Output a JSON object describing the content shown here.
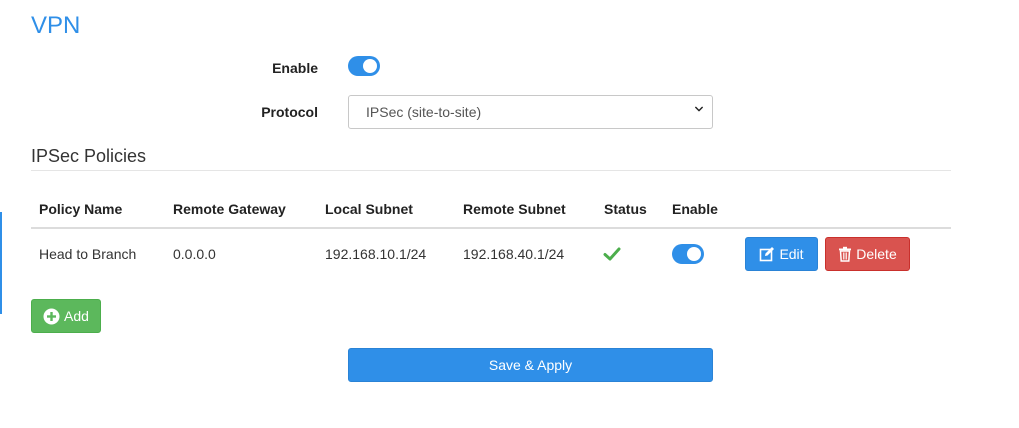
{
  "page": {
    "title": "VPN"
  },
  "form": {
    "enable_label": "Enable",
    "enable_on": true,
    "protocol_label": "Protocol",
    "protocol_value": "IPSec (site-to-site)"
  },
  "policies": {
    "section_title": "IPSec Policies",
    "columns": [
      "Policy Name",
      "Remote Gateway",
      "Local Subnet",
      "Remote Subnet",
      "Status",
      "Enable"
    ],
    "rows": [
      {
        "policy_name": "Head to Branch",
        "remote_gateway": "0.0.0.0",
        "local_subnet": "192.168.10.1/24",
        "remote_subnet": "192.168.40.1/24",
        "status_icon": "check-icon",
        "enabled": true,
        "edit_label": "Edit",
        "delete_label": "Delete"
      }
    ],
    "add_label": "Add"
  },
  "actions": {
    "save_label": "Save & Apply"
  },
  "colors": {
    "primary": "#2f8fe8",
    "success": "#5cb85c",
    "danger": "#d9534f",
    "status_ok": "#4cae4c"
  }
}
